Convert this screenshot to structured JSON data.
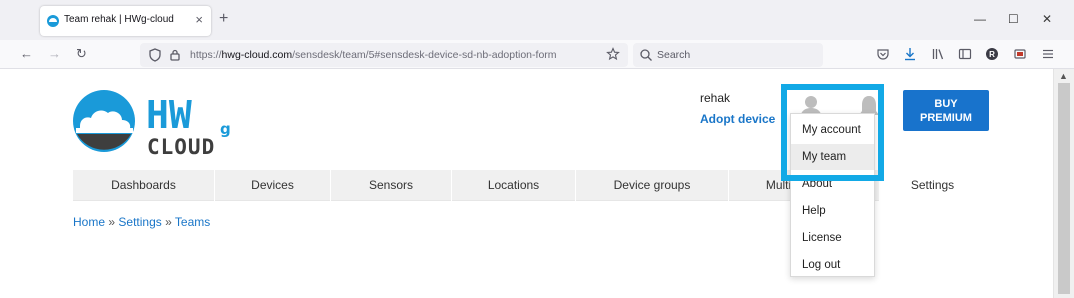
{
  "browser": {
    "tab": {
      "title": "Team rehak | HWg-cloud",
      "close": "×"
    },
    "new_tab": "+",
    "window": {
      "minimize": "—",
      "maximize": "☐",
      "close": "✕"
    },
    "nav": {
      "back": "←",
      "forward": "→",
      "reload": "↻"
    },
    "url": {
      "prefix": "https://",
      "domain": "hwg-cloud.com",
      "path": "/sensdesk/team/5#sensdesk-device-sd-nb-adoption-form"
    },
    "search_placeholder": "Search"
  },
  "header": {
    "username": "rehak",
    "adopt_link": "Adopt device",
    "buy_button": {
      "line1": "BUY",
      "line2": "PREMIUM"
    }
  },
  "logo": {
    "text_top": "HW",
    "text_sub": "g",
    "text_bottom": "CLOUD"
  },
  "menu": {
    "items": [
      "Dashboards",
      "Devices",
      "Sensors",
      "Locations",
      "Device groups",
      "Multi",
      "Settings"
    ]
  },
  "breadcrumb": {
    "home": "Home",
    "settings": "Settings",
    "teams": "Teams",
    "sep": "»"
  },
  "user_dropdown": {
    "items": [
      "My account",
      "My team",
      "About",
      "Help",
      "License",
      "Log out"
    ],
    "active": "My team"
  },
  "colors": {
    "accent": "#1873cc",
    "highlight": "#12a9e6",
    "link": "#1a76c8"
  }
}
